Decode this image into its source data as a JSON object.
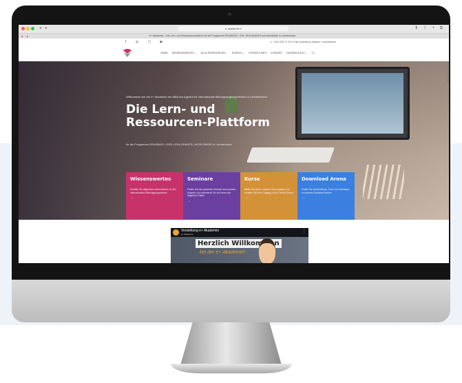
{
  "browser": {
    "address": "e-akademie.li",
    "tab_title": "e+ Akademie – Die Lern- und Ressourcenplattform für die Programme ERASMUS+, ESK, EEA GRANTS und WorldWide in Liechtenstein",
    "nav_buttons": "◂ ▸",
    "right_icons": "⬇ ⇪ + ⧉"
  },
  "topbar": {
    "socials": "f ◎ ▢ ▶",
    "contact": "☏ +423 236 72 20   ✉ Villa Gutenberg / Balzers, Liechtenstein"
  },
  "nav": {
    "items": [
      "HOME",
      "WISSENSWERTES ⌄",
      "ALLE RESSOURCEN ⌄",
      "EVENTS ⌄",
      "EXPERTS INFO",
      "KONTAKT",
      "DATENSCHUTZ ⌄",
      "🔍"
    ]
  },
  "hero": {
    "welcome": "Willkommen bei der e+ Akademie der AIBA der Agentur für internationale Bildungsangelegenheiten in Liechtenstein!",
    "title_line1": "Die Lern- und",
    "title_line2": "Ressourcen-Plattform",
    "subline": "für die Programme ERASMUS+ | ESK | EEA GRANTS | WORLDWIDE in Liechtenstein"
  },
  "cards": [
    {
      "title": "Wissenswertes",
      "desc": "Erhalten Sie allgemeine Informationen zu den internationalen Bildungsprogrammen",
      "arrow": "→",
      "color": "#c8326a"
    },
    {
      "title": "Seminare",
      "desc": "Finden Sie das passende Seminar aus unserem Angebot und reservieren Sie sich einen der begehrten Plätze",
      "arrow": "→",
      "color": "#6b3fa0"
    },
    {
      "title": "Kurse",
      "desc": "Bilden Sie sich in unseren Kurs-Angebot und erhalten Sie Ihren Zugang zu den Online-Kursen",
      "arrow": "→",
      "color": "#d49238"
    },
    {
      "title": "Download Arena",
      "desc": "Finden Sie Informationen, Tools und Unterlagen in unserem Download Bereich",
      "arrow": "→",
      "color": "#3b7fe0"
    }
  ],
  "video": {
    "title": "Vorstellung e+ Akademie",
    "channel": "e+ Akademie",
    "headline": "Herzlich Willkommen",
    "subheadline": "bei der e+ Akademie!",
    "menu": "⋮"
  }
}
